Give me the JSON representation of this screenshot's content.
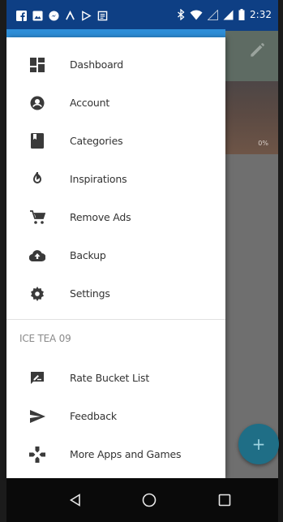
{
  "status_bar": {
    "time": "2:32",
    "left_icons": [
      "facebook-icon",
      "image-icon",
      "messenger-icon",
      "app-icon",
      "play-icon",
      "clipboard-icon"
    ],
    "right_icons": [
      "bluetooth-icon",
      "wifi-icon",
      "signal-icon",
      "cell-signal-icon",
      "battery-icon"
    ]
  },
  "background_app": {
    "hero_percent": "0%",
    "fab_label": "+"
  },
  "drawer": {
    "items": [
      {
        "label": "Dashboard",
        "icon": "dashboard-icon"
      },
      {
        "label": "Account",
        "icon": "account-icon"
      },
      {
        "label": "Categories",
        "icon": "book-icon"
      },
      {
        "label": "Inspirations",
        "icon": "flame-icon"
      },
      {
        "label": "Remove Ads",
        "icon": "cart-icon"
      },
      {
        "label": "Backup",
        "icon": "cloud-upload-icon"
      },
      {
        "label": "Settings",
        "icon": "gear-icon"
      }
    ],
    "section_header": "ICE TEA 09",
    "section_items": [
      {
        "label": "Rate Bucket List",
        "icon": "rate-review-icon"
      },
      {
        "label": "Feedback",
        "icon": "send-icon"
      },
      {
        "label": "More Apps and Games",
        "icon": "games-icon"
      }
    ]
  },
  "nav_bar": {
    "buttons": [
      "back-icon",
      "home-icon",
      "recents-icon"
    ]
  },
  "colors": {
    "status_bar": "#0e3f84",
    "accent": "#2e8ed8",
    "drawer_bg": "#ffffff",
    "icon": "#3a3a3a",
    "fab": "#1f6e86"
  }
}
